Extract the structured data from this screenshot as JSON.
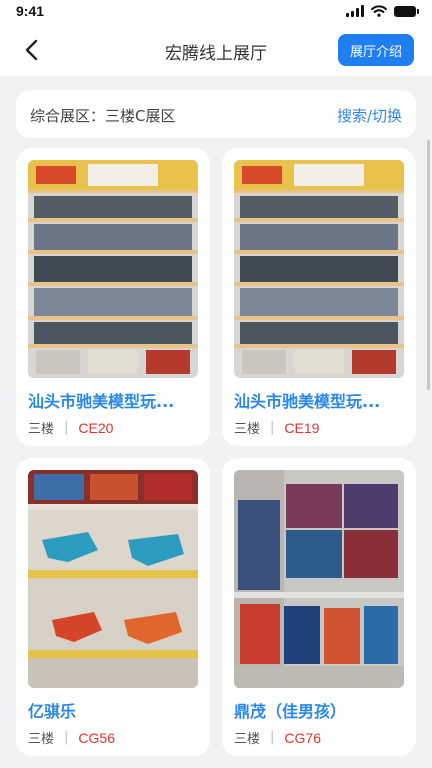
{
  "status": {
    "time": "9:41"
  },
  "nav": {
    "title": "宏腾线上展厅",
    "intro_button": "展厅介绍"
  },
  "area": {
    "label": "综合展区：三楼C展区",
    "action": "搜索/切换"
  },
  "cards": [
    {
      "title": "汕头市驰美模型玩...",
      "floor": "三楼",
      "separator": "|",
      "booth": "CE20",
      "image": "shelf-toy-cars"
    },
    {
      "title": "汕头市驰美模型玩...",
      "floor": "三楼",
      "separator": "|",
      "booth": "CE19",
      "image": "shelf-toy-cars"
    },
    {
      "title": "亿骐乐",
      "floor": "三楼",
      "separator": "|",
      "booth": "CG56",
      "image": "shelf-toy-guns"
    },
    {
      "title": "鼎茂（佳男孩）",
      "floor": "三楼",
      "separator": "|",
      "booth": "CG76",
      "image": "shelf-robot-boxes"
    }
  ],
  "colors": {
    "accent": "#1f7ff0",
    "link": "#2a87e6",
    "booth": "#e0342d",
    "background": "#f1f2f4"
  }
}
